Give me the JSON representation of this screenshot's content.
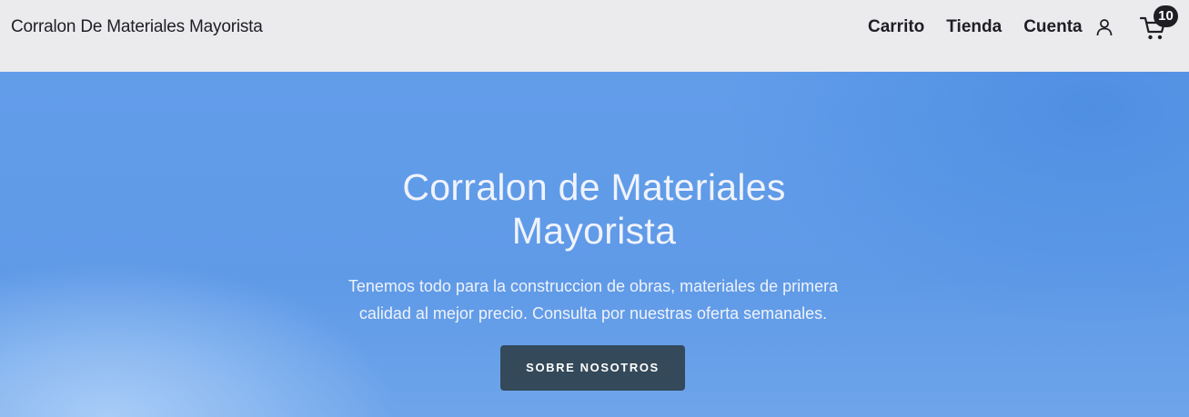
{
  "header": {
    "site_title": "Corralon De Materiales Mayorista",
    "nav": [
      {
        "label": "Carrito"
      },
      {
        "label": "Tienda"
      },
      {
        "label": "Cuenta"
      }
    ],
    "account_icon": "user-icon",
    "cart_icon": "shopping-cart-icon",
    "cart_count": "10"
  },
  "hero": {
    "title": "Corralon de Materiales Mayorista",
    "text": "Tenemos todo para la construccion de obras, materiales de primera calidad al mejor precio. Consulta por nuestras oferta semanales.",
    "button_label": "SOBRE NOSOTROS"
  },
  "colors": {
    "header_bg": "#ebebee",
    "hero_blue": "#629dea",
    "button_bg": "#34495a",
    "text_dark": "#1e1e24"
  }
}
